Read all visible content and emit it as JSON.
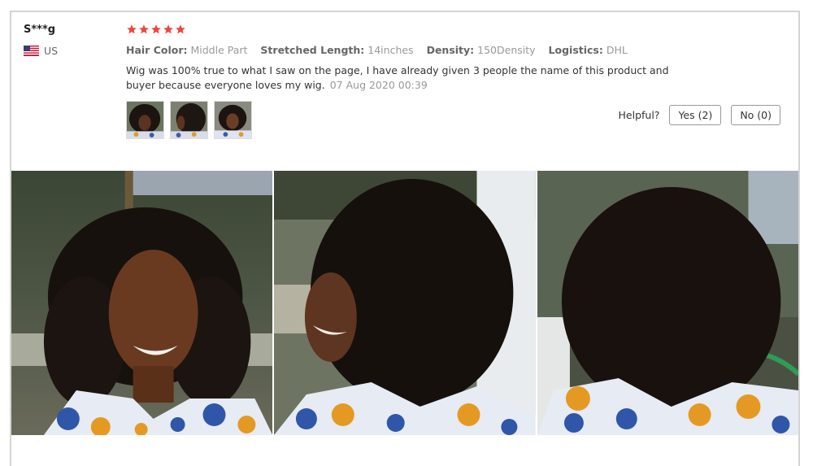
{
  "review": {
    "user_name": "S***g",
    "country_code": "US",
    "flag_icon": "us-flag-icon",
    "rating": 5,
    "star_color": "#f0453a",
    "attributes": [
      {
        "label": "Hair Color:",
        "value": "Middle Part"
      },
      {
        "label": "Stretched Length:",
        "value": "14inches"
      },
      {
        "label": "Density:",
        "value": "150Density"
      },
      {
        "label": "Logistics:",
        "value": "DHL"
      }
    ],
    "text": "Wig was 100% true to what I saw on the page, I have already given 3 people the name of this product and buyer because everyone loves my wig.",
    "date": "07 Aug 2020 00:39"
  },
  "helpful": {
    "label": "Helpful?",
    "yes_label": "Yes (2)",
    "no_label": "No (0)"
  }
}
